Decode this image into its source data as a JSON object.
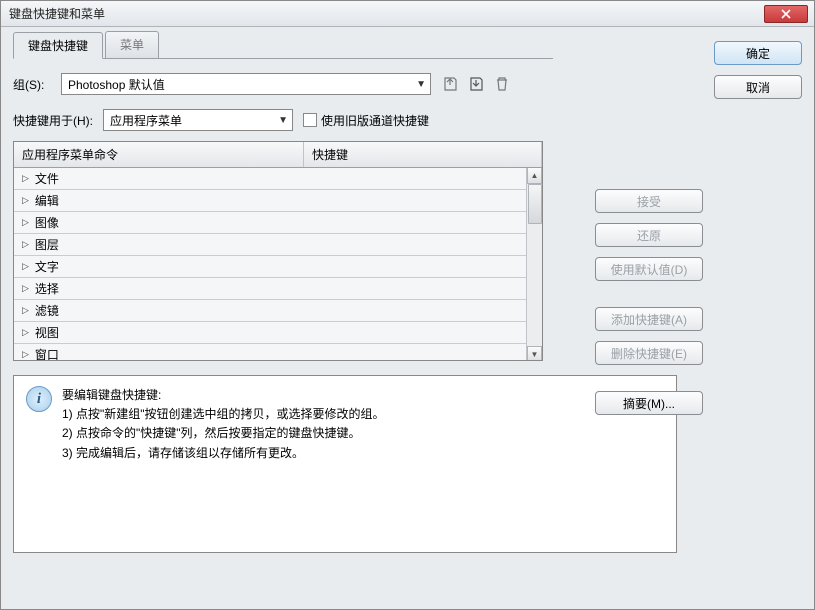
{
  "window": {
    "title": "键盘快捷键和菜单"
  },
  "tabs": {
    "shortcuts": "键盘快捷键",
    "menus": "菜单"
  },
  "set": {
    "label": "组(S):",
    "value": "Photoshop 默认值"
  },
  "shortcutFor": {
    "label": "快捷键用于(H):",
    "value": "应用程序菜单"
  },
  "legacy": {
    "label": "使用旧版通道快捷键"
  },
  "table": {
    "col1": "应用程序菜单命令",
    "col2": "快捷键",
    "rows": [
      "文件",
      "编辑",
      "图像",
      "图层",
      "文字",
      "选择",
      "滤镜",
      "视图",
      "窗口"
    ]
  },
  "actions": {
    "accept": "接受",
    "undo": "还原",
    "useDefault": "使用默认值(D)",
    "addShortcut": "添加快捷键(A)",
    "deleteShortcut": "删除快捷键(E)",
    "summary": "摘要(M)..."
  },
  "dialog": {
    "ok": "确定",
    "cancel": "取消"
  },
  "info": {
    "heading": "要编辑键盘快捷键:",
    "line1": "1) 点按\"新建组\"按钮创建选中组的拷贝，或选择要修改的组。",
    "line2": "2) 点按命令的\"快捷键\"列，然后按要指定的键盘快捷键。",
    "line3": "3) 完成编辑后，请存储该组以存储所有更改。"
  }
}
